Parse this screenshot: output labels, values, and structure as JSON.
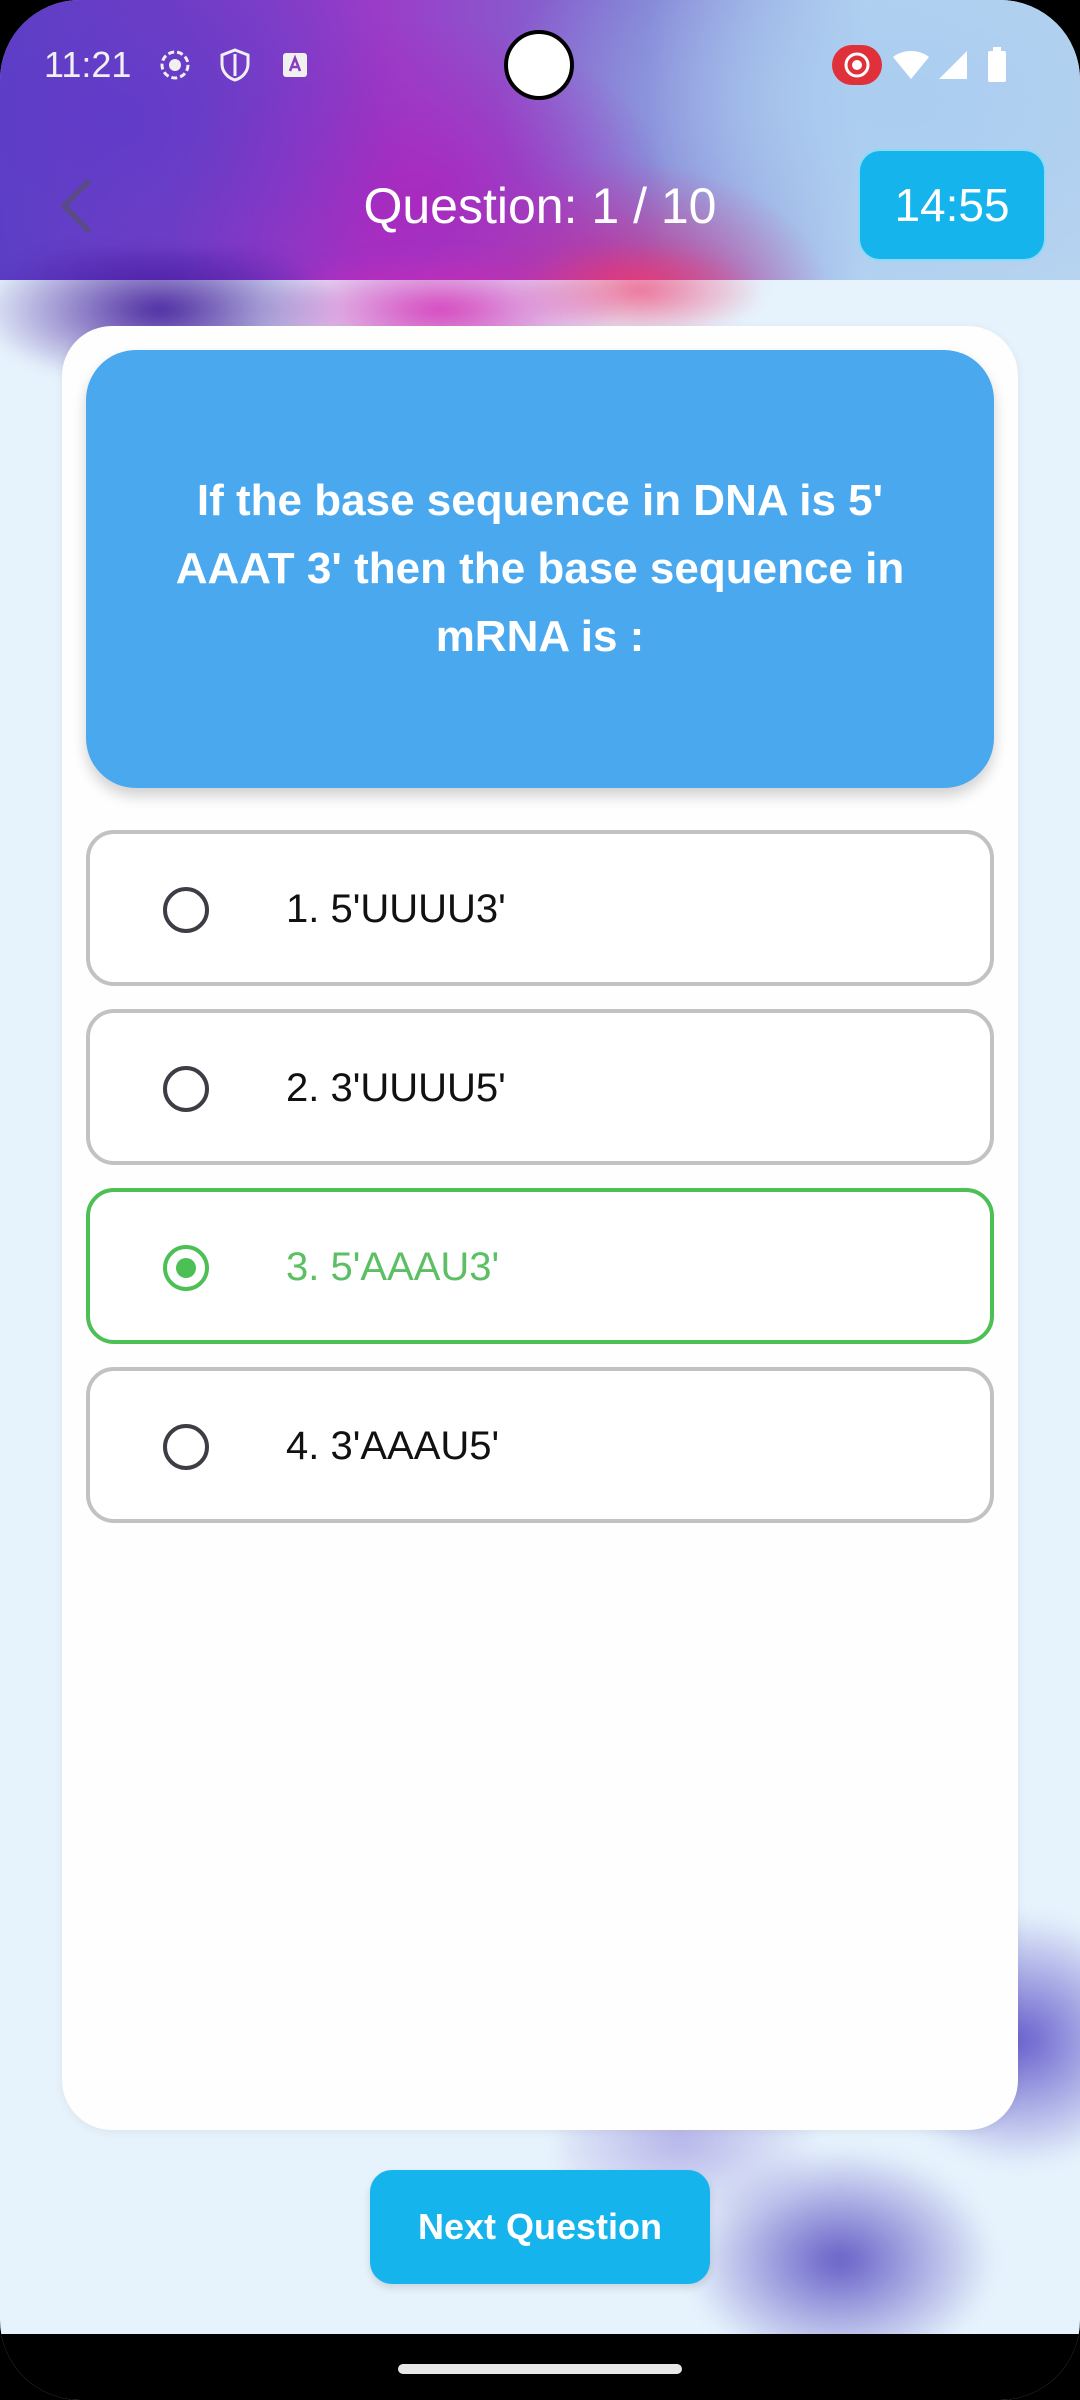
{
  "status_bar": {
    "time": "11:21",
    "icons": [
      "screen-record-icon",
      "shield-icon",
      "keyboard-a-icon",
      "cast-record-icon",
      "wifi-icon",
      "signal-icon",
      "battery-icon"
    ]
  },
  "header": {
    "title": "Question: 1 / 10",
    "timer": "14:55",
    "back_icon": "chevron-left-icon"
  },
  "question": {
    "text": "If the base sequence in DNA is 5' AAAT 3' then the base sequence in mRNA is :"
  },
  "options": [
    {
      "label": "1. 5'UUUU3'",
      "selected": false
    },
    {
      "label": "2. 3'UUUU5'",
      "selected": false
    },
    {
      "label": "3. 5'AAAU3'",
      "selected": true
    },
    {
      "label": "4. 3'AAAU5'",
      "selected": false
    }
  ],
  "next_button": {
    "label": "Next Question"
  },
  "colors": {
    "accent": "#16b4ec",
    "question_bg": "#4aa8ef",
    "selected": "#4cbf55",
    "option_border": "#c2c2c2"
  }
}
